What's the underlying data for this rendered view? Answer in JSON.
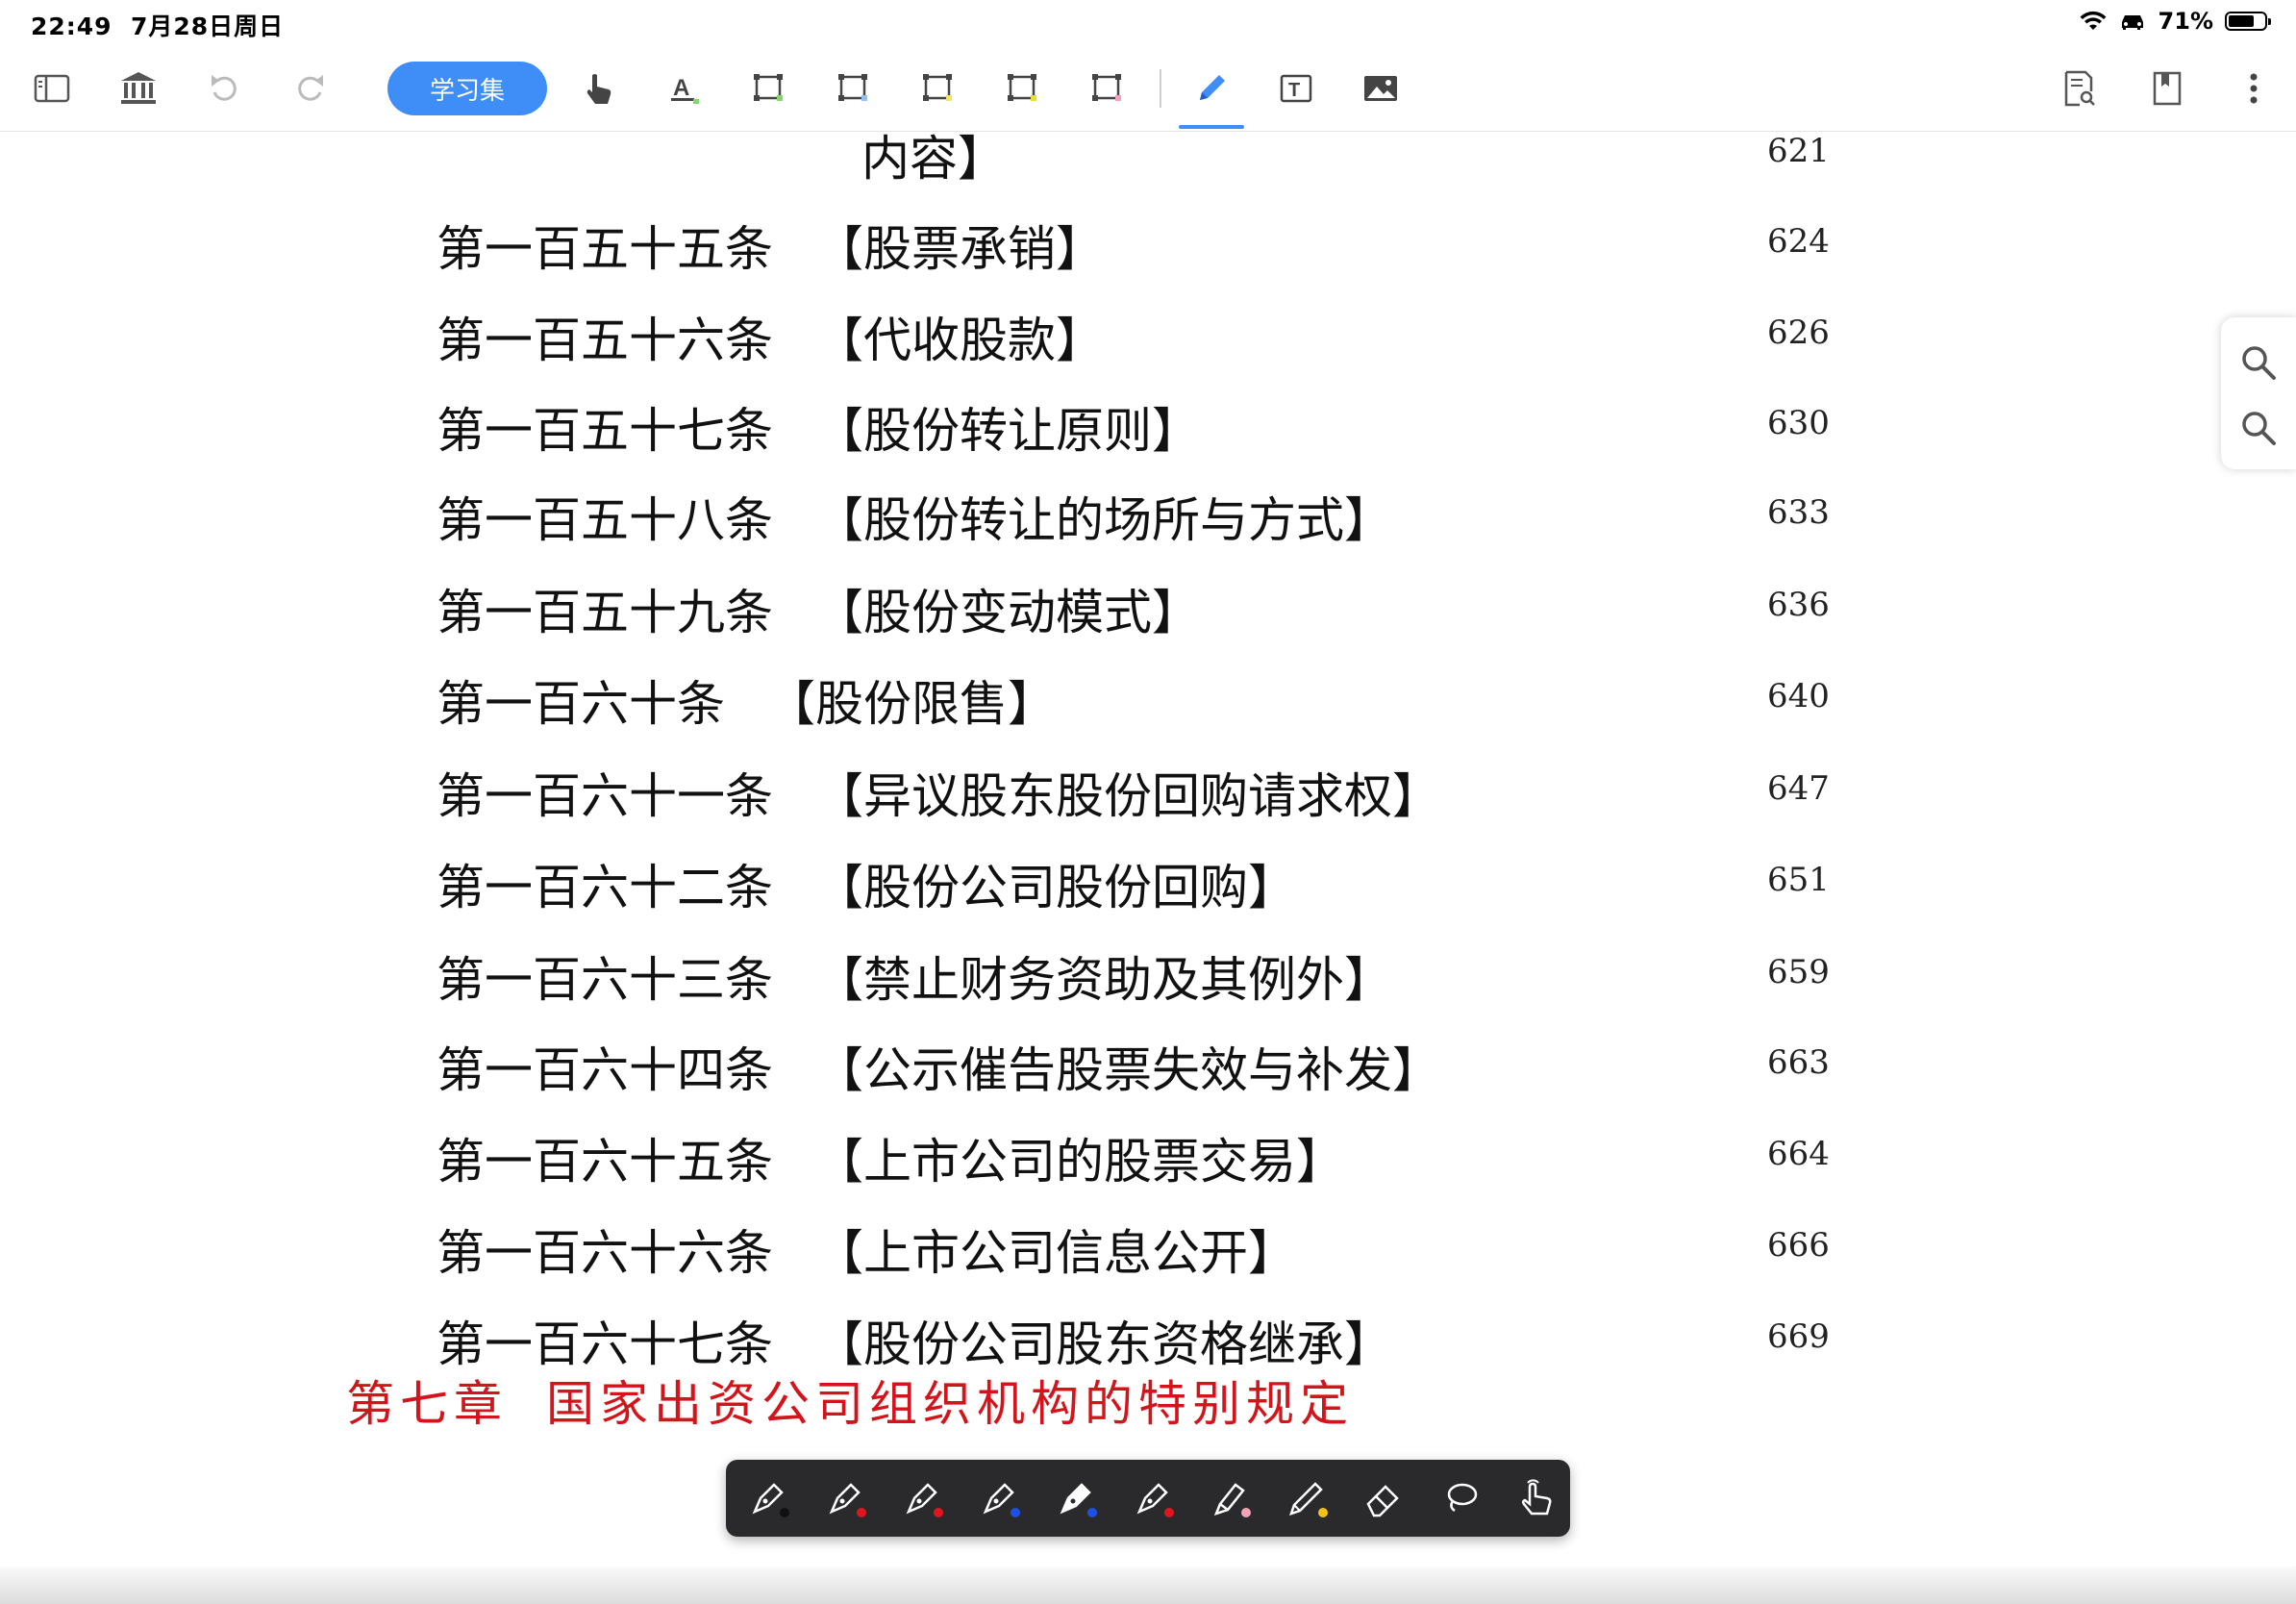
{
  "status_bar": {
    "time": "22:49",
    "date": "7月28日周日",
    "battery": "71%",
    "battery_level": 0.71
  },
  "toolbar": {
    "study_set_label": "学习集",
    "icons": [
      "sidebar-icon",
      "library-icon",
      "undo-icon",
      "redo-icon",
      "hand-icon",
      "text-highlight-icon",
      "rect-select-green-icon",
      "rect-select-blue-icon",
      "rect-select-yellow-icon",
      "rect-select-yellowgreen-icon",
      "rect-select-pink-icon",
      "pen-icon",
      "text-box-icon",
      "image-icon",
      "search-document-icon",
      "bookmark-icon",
      "more-icon"
    ]
  },
  "document": {
    "top_partial": {
      "title": "内容】",
      "page": "621"
    },
    "entries": [
      {
        "article": "第一百五十五条",
        "title": "【股票承销】",
        "page": "624"
      },
      {
        "article": "第一百五十六条",
        "title": "【代收股款】",
        "page": "626"
      },
      {
        "article": "第一百五十七条",
        "title": "【股份转让原则】",
        "page": "630"
      },
      {
        "article": "第一百五十八条",
        "title": "【股份转让的场所与方式】",
        "page": "633"
      },
      {
        "article": "第一百五十九条",
        "title": "【股份变动模式】",
        "page": "636"
      },
      {
        "article": "第一百六十条",
        "title": "【股份限售】",
        "page": "640"
      },
      {
        "article": "第一百六十一条",
        "title": "【异议股东股份回购请求权】",
        "page": "647"
      },
      {
        "article": "第一百六十二条",
        "title": "【股份公司股份回购】",
        "page": "651"
      },
      {
        "article": "第一百六十三条",
        "title": "【禁止财务资助及其例外】",
        "page": "659"
      },
      {
        "article": "第一百六十四条",
        "title": "【公示催告股票失效与补发】",
        "page": "663"
      },
      {
        "article": "第一百六十五条",
        "title": "【上市公司的股票交易】",
        "page": "664"
      },
      {
        "article": "第一百六十六条",
        "title": "【上市公司信息公开】",
        "page": "666"
      },
      {
        "article": "第一百六十七条",
        "title": "【股份公司股东资格继承】",
        "page": "669"
      }
    ],
    "chapter": {
      "number": "第七章",
      "title": "国家出资公司组织机构的特别规定"
    }
  },
  "side_panel": {
    "icons": [
      "search-icon",
      "search-icon"
    ]
  },
  "pen_palette": {
    "tools": [
      {
        "name": "fountain-pen-black-icon",
        "color": "#111111"
      },
      {
        "name": "fountain-pen-red-icon",
        "color": "#e0161d"
      },
      {
        "name": "fountain-pen-red-2-icon",
        "color": "#e0161d"
      },
      {
        "name": "fountain-pen-blue-icon",
        "color": "#1e50e6"
      },
      {
        "name": "fountain-pen-blue-selected-icon",
        "color": "#1e50e6"
      },
      {
        "name": "fountain-pen-red-3-icon",
        "color": "#e0161d"
      },
      {
        "name": "highlighter-pink-icon",
        "color": "#f2a3b4"
      },
      {
        "name": "pencil-yellow-icon",
        "color": "#f2c21a"
      },
      {
        "name": "eraser-icon",
        "color": ""
      },
      {
        "name": "lasso-icon",
        "color": ""
      },
      {
        "name": "touch-hand-icon",
        "color": ""
      }
    ]
  }
}
